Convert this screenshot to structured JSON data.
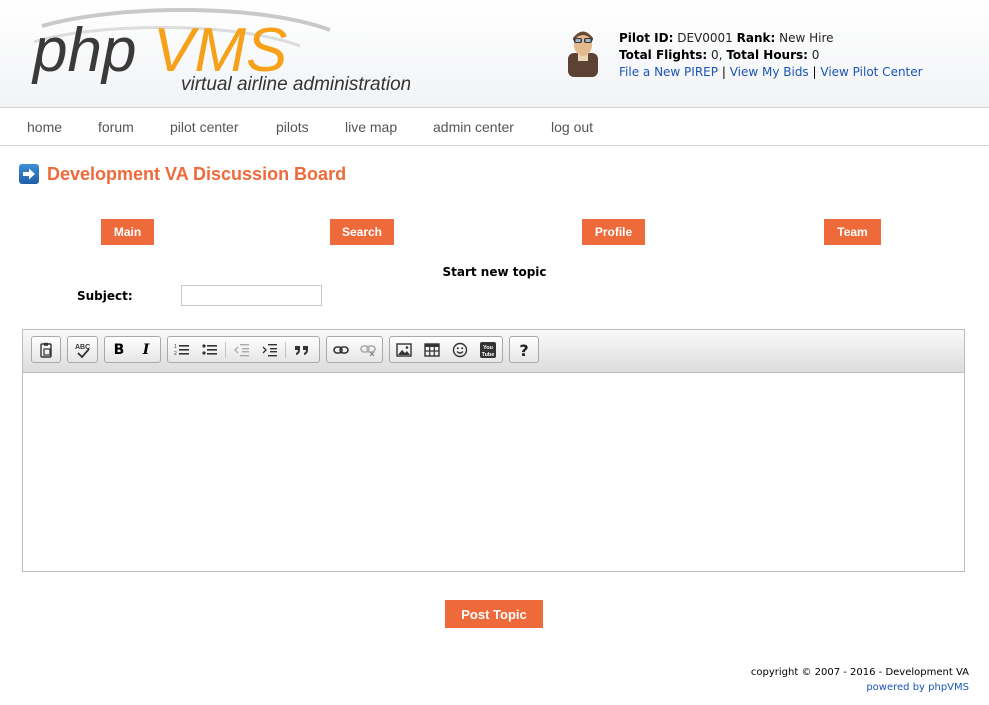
{
  "logo": {
    "brand_php": "php",
    "brand_vms": "VMS",
    "tagline": "virtual airline administration"
  },
  "pilot": {
    "id_label": "Pilot ID:",
    "id_value": "DEV0001",
    "rank_label": "Rank:",
    "rank_value": "New Hire",
    "flights_label": "Total Flights:",
    "flights_value": "0",
    "hours_label": "Total Hours:",
    "hours_value": "0",
    "links": [
      "File a New PIREP",
      "View My Bids",
      "View Pilot Center"
    ],
    "link_separator": "|"
  },
  "nav": {
    "items": [
      "home",
      "forum",
      "pilot center",
      "pilots",
      "live map",
      "admin center",
      "log out"
    ]
  },
  "page": {
    "title": "Development VA Discussion Board"
  },
  "forum_buttons": [
    "Main",
    "Search",
    "Profile",
    "Team"
  ],
  "form": {
    "heading": "Start new topic",
    "subject_label": "Subject:",
    "subject_value": "",
    "submit_label": "Post Topic"
  },
  "editor": {
    "toolbar_icons": [
      "paste-text-icon",
      "spellcheck-icon",
      "bold-icon",
      "italic-icon",
      "numbered-list-icon",
      "bullet-list-icon",
      "outdent-icon",
      "indent-icon",
      "blockquote-icon",
      "link-icon",
      "unlink-icon",
      "image-icon",
      "table-icon",
      "smiley-icon",
      "youtube-icon",
      "help-icon"
    ],
    "bold_glyph": "B",
    "italic_glyph": "I",
    "help_glyph": "?",
    "youtube_text": "You Tube"
  },
  "footer": {
    "copyright": "copyright © 2007 - 2016 - Development VA",
    "powered": "powered by phpVMS"
  },
  "colors": {
    "accent": "#ee6a3a",
    "link": "#1a55b8",
    "logo_orange": "#f7a11a",
    "logo_dark": "#3a3a3a"
  }
}
